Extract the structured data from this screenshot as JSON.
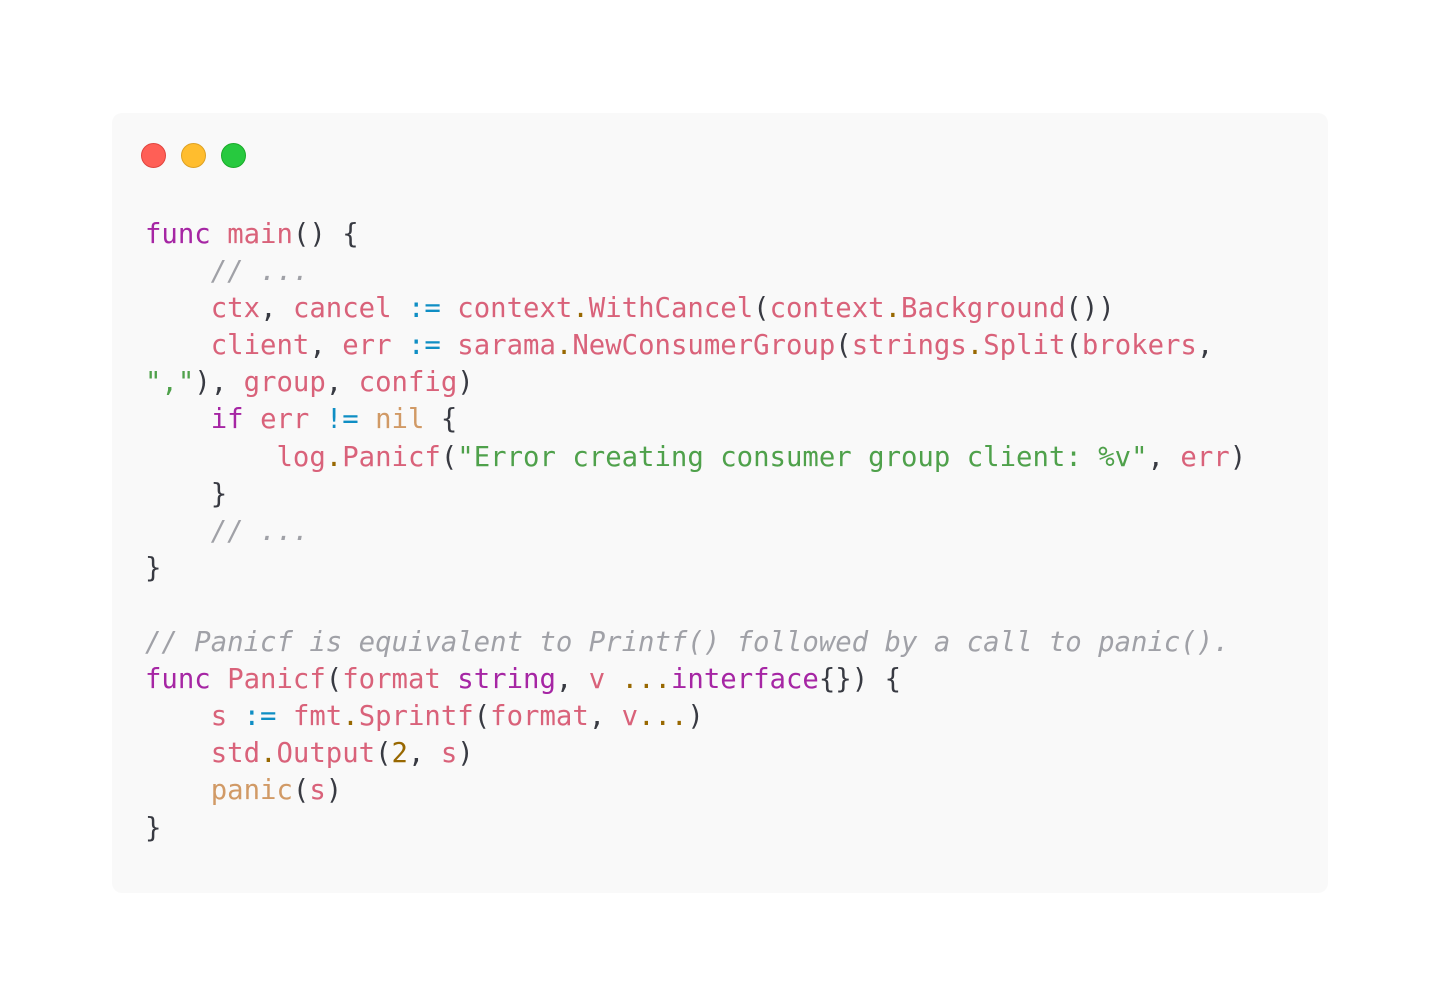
{
  "window": {
    "controls": {
      "close_color": "#ff5f56",
      "minimize_color": "#ffbd2e",
      "maximize_color": "#27c93f"
    }
  },
  "code": {
    "language": "go",
    "lines": [
      [
        [
          "kw",
          "func"
        ],
        [
          "pl",
          " "
        ],
        [
          "fn",
          "main"
        ],
        [
          "pl",
          "() {"
        ]
      ],
      [
        [
          "pl",
          "    "
        ],
        [
          "cm",
          "// ..."
        ]
      ],
      [
        [
          "pl",
          "    "
        ],
        [
          "var",
          "ctx"
        ],
        [
          "pl",
          ", "
        ],
        [
          "var",
          "cancel"
        ],
        [
          "pl",
          " "
        ],
        [
          "op",
          ":="
        ],
        [
          "pl",
          " "
        ],
        [
          "var",
          "context"
        ],
        [
          "dot",
          "."
        ],
        [
          "fn",
          "WithCancel"
        ],
        [
          "pl",
          "("
        ],
        [
          "var",
          "context"
        ],
        [
          "dot",
          "."
        ],
        [
          "fn",
          "Background"
        ],
        [
          "pl",
          "())"
        ]
      ],
      [
        [
          "pl",
          "    "
        ],
        [
          "var",
          "client"
        ],
        [
          "pl",
          ", "
        ],
        [
          "var",
          "err"
        ],
        [
          "pl",
          " "
        ],
        [
          "op",
          ":="
        ],
        [
          "pl",
          " "
        ],
        [
          "var",
          "sarama"
        ],
        [
          "dot",
          "."
        ],
        [
          "fn",
          "NewConsumerGroup"
        ],
        [
          "pl",
          "("
        ],
        [
          "var",
          "strings"
        ],
        [
          "dot",
          "."
        ],
        [
          "fn",
          "Split"
        ],
        [
          "pl",
          "("
        ],
        [
          "var",
          "brokers"
        ],
        [
          "pl",
          ","
        ]
      ],
      [
        [
          "str",
          "\",\""
        ],
        [
          "pl",
          "), "
        ],
        [
          "var",
          "group"
        ],
        [
          "pl",
          ", "
        ],
        [
          "var",
          "config"
        ],
        [
          "pl",
          ")"
        ]
      ],
      [
        [
          "pl",
          "    "
        ],
        [
          "kw",
          "if"
        ],
        [
          "pl",
          " "
        ],
        [
          "var",
          "err"
        ],
        [
          "pl",
          " "
        ],
        [
          "op",
          "!="
        ],
        [
          "pl",
          " "
        ],
        [
          "bi",
          "nil"
        ],
        [
          "pl",
          " {"
        ]
      ],
      [
        [
          "pl",
          "        "
        ],
        [
          "var",
          "log"
        ],
        [
          "dot",
          "."
        ],
        [
          "fn",
          "Panicf"
        ],
        [
          "pl",
          "("
        ],
        [
          "str",
          "\"Error creating consumer group client: %v\""
        ],
        [
          "pl",
          ", "
        ],
        [
          "var",
          "err"
        ],
        [
          "pl",
          ")"
        ]
      ],
      [
        [
          "pl",
          "    }"
        ]
      ],
      [
        [
          "pl",
          "    "
        ],
        [
          "cm",
          "// ..."
        ]
      ],
      [
        [
          "pl",
          "}"
        ]
      ],
      [],
      [
        [
          "cm",
          "// Panicf is equivalent to Printf() followed by a call to panic()."
        ]
      ],
      [
        [
          "kw",
          "func"
        ],
        [
          "pl",
          " "
        ],
        [
          "fn",
          "Panicf"
        ],
        [
          "pl",
          "("
        ],
        [
          "var",
          "format"
        ],
        [
          "pl",
          " "
        ],
        [
          "kw",
          "string"
        ],
        [
          "pl",
          ", "
        ],
        [
          "var",
          "v"
        ],
        [
          "pl",
          " "
        ],
        [
          "dot",
          "..."
        ],
        [
          "kw",
          "interface"
        ],
        [
          "pl",
          "{}) {"
        ]
      ],
      [
        [
          "pl",
          "    "
        ],
        [
          "var",
          "s"
        ],
        [
          "pl",
          " "
        ],
        [
          "op",
          ":="
        ],
        [
          "pl",
          " "
        ],
        [
          "var",
          "fmt"
        ],
        [
          "dot",
          "."
        ],
        [
          "fn",
          "Sprintf"
        ],
        [
          "pl",
          "("
        ],
        [
          "var",
          "format"
        ],
        [
          "pl",
          ", "
        ],
        [
          "var",
          "v"
        ],
        [
          "dot",
          "..."
        ],
        [
          "pl",
          ")"
        ]
      ],
      [
        [
          "pl",
          "    "
        ],
        [
          "var",
          "std"
        ],
        [
          "dot",
          "."
        ],
        [
          "fn",
          "Output"
        ],
        [
          "pl",
          "("
        ],
        [
          "num",
          "2"
        ],
        [
          "pl",
          ", "
        ],
        [
          "var",
          "s"
        ],
        [
          "pl",
          ")"
        ]
      ],
      [
        [
          "pl",
          "    "
        ],
        [
          "bi",
          "panic"
        ],
        [
          "pl",
          "("
        ],
        [
          "var",
          "s"
        ],
        [
          "pl",
          ")"
        ]
      ],
      [
        [
          "pl",
          "}"
        ]
      ]
    ]
  }
}
